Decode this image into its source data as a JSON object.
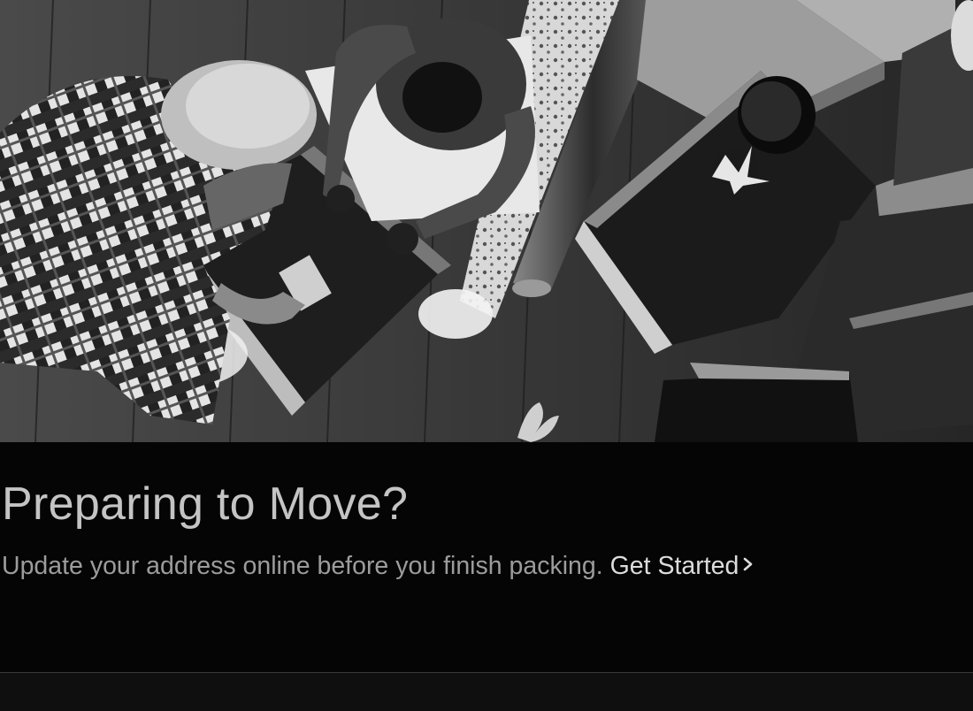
{
  "promo": {
    "title": "Preparing to Move?",
    "body": "Update your address online before you finish packing.",
    "cta_label": "Get Started",
    "cta_icon": "chevron-right-icon"
  },
  "colors": {
    "background": "#050505",
    "title": "#c4c4c4",
    "body": "#9c9c9c",
    "cta": "#dcdcdc"
  }
}
